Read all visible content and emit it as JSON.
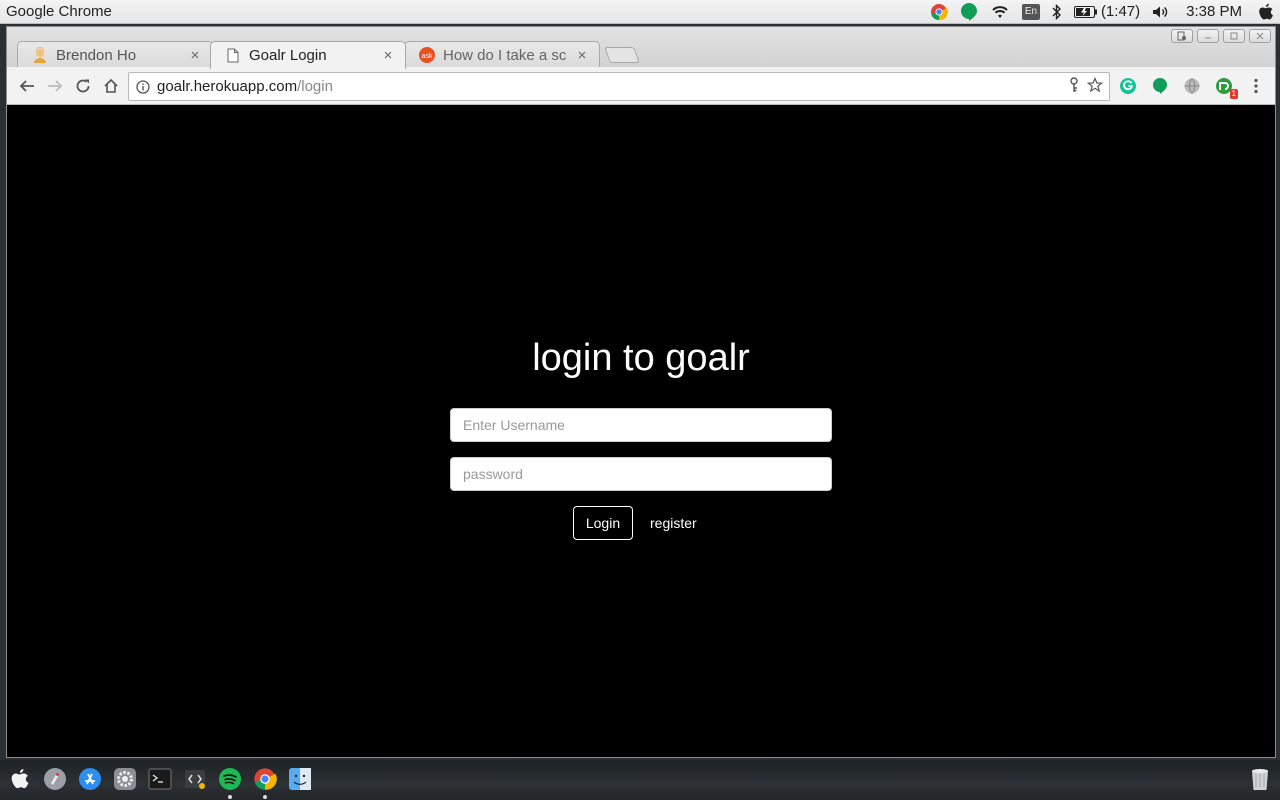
{
  "menubar": {
    "app_name": "Google Chrome",
    "lang": "En",
    "battery": "(1:47)",
    "clock": "3:38 PM",
    "tray_icons": [
      "chrome-icon",
      "hangouts-icon",
      "wifi-icon",
      "input-language-icon",
      "bluetooth-icon",
      "battery-icon",
      "volume-icon",
      "apple-icon"
    ]
  },
  "tabs": [
    {
      "title": "Brendon Ho",
      "icon": "user-avatar-icon",
      "active": false
    },
    {
      "title": "Goalr Login",
      "icon": "page-icon",
      "active": true
    },
    {
      "title": "How do I take a sc",
      "icon": "ask-icon",
      "active": false
    }
  ],
  "tab_close": "×",
  "ask_favicon_text": "ask",
  "address_bar": {
    "host": "goalr.herokuapp.com",
    "path": "/login"
  },
  "extensions": {
    "badge": "1"
  },
  "page": {
    "title": "login to goalr",
    "username_placeholder": "Enter Username",
    "password_placeholder": "password",
    "login_label": "Login",
    "register_label": "register"
  },
  "dock": {
    "items": [
      "finder-apple-icon",
      "launchpad-icon",
      "app-store-icon",
      "system-preferences-icon",
      "terminal-icon",
      "script-editor-icon",
      "spotify-icon",
      "chrome-icon",
      "finder-icon",
      "trash-icon"
    ]
  },
  "colors": {
    "page_bg": "#000000",
    "text": "#ffffff",
    "hangouts_green": "#0f9d58",
    "spotify_green": "#1db954"
  }
}
